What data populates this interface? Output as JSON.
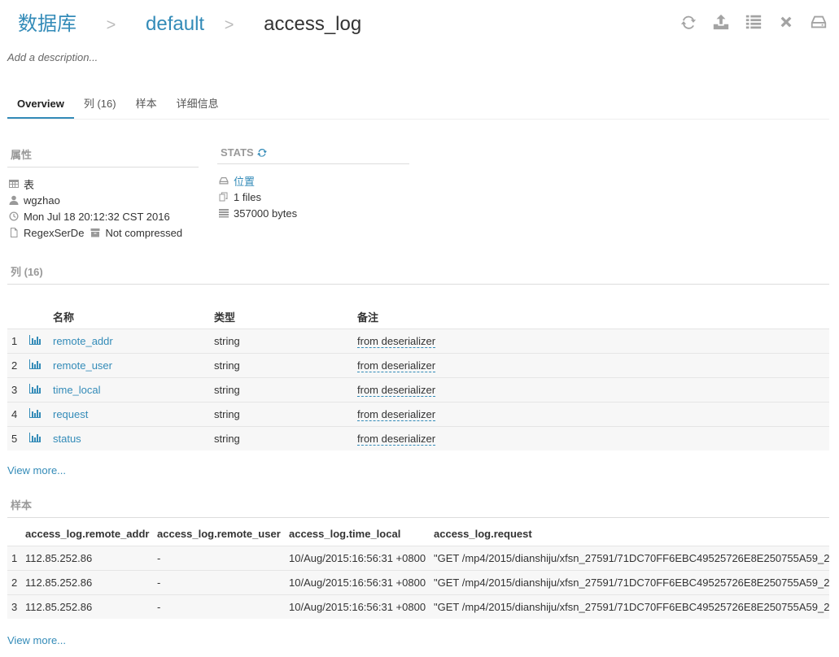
{
  "breadcrumb": {
    "database_label": "数据库",
    "sep1": ">",
    "db_name": "default",
    "sep2": ">",
    "table_name": "access_log"
  },
  "toolbar": {
    "icons": [
      "refresh-icon",
      "upload-icon",
      "list-icon",
      "close-icon",
      "drive-icon"
    ]
  },
  "description_placeholder": "Add a description...",
  "tabs": [
    {
      "label": "Overview",
      "active": true
    },
    {
      "label": "列 (16)",
      "active": false
    },
    {
      "label": "样本",
      "active": false
    },
    {
      "label": "详细信息",
      "active": false
    }
  ],
  "properties": {
    "title": "属性",
    "type": "表",
    "owner": "wgzhao",
    "created": "Mon Jul 18 20:12:32 CST 2016",
    "serde": "RegexSerDe",
    "compression": "Not compressed"
  },
  "stats": {
    "title": "STATS",
    "location_label": "位置",
    "files": "1 files",
    "bytes": "357000 bytes"
  },
  "columns_section": {
    "title": "列 (16)",
    "headers": {
      "name": "名称",
      "type": "类型",
      "comment": "备注"
    },
    "rows": [
      {
        "index": "1",
        "name": "remote_addr",
        "type": "string",
        "comment": "from deserializer"
      },
      {
        "index": "2",
        "name": "remote_user",
        "type": "string",
        "comment": "from deserializer"
      },
      {
        "index": "3",
        "name": "time_local",
        "type": "string",
        "comment": "from deserializer"
      },
      {
        "index": "4",
        "name": "request",
        "type": "string",
        "comment": "from deserializer"
      },
      {
        "index": "5",
        "name": "status",
        "type": "string",
        "comment": "from deserializer"
      }
    ],
    "view_more": "View more..."
  },
  "sample_section": {
    "title": "样本",
    "headers": [
      "access_log.remote_addr",
      "access_log.remote_user",
      "access_log.time_local",
      "access_log.request"
    ],
    "rows": [
      {
        "index": "1",
        "cells": [
          "112.85.252.86",
          "-",
          "10/Aug/2015:16:56:31 +0800",
          "\"GET /mp4/2015/dianshiju/xfsn_27591/71DC70FF6EBC49525726E8E250755A59_2"
        ]
      },
      {
        "index": "2",
        "cells": [
          "112.85.252.86",
          "-",
          "10/Aug/2015:16:56:31 +0800",
          "\"GET /mp4/2015/dianshiju/xfsn_27591/71DC70FF6EBC49525726E8E250755A59_2"
        ]
      },
      {
        "index": "3",
        "cells": [
          "112.85.252.86",
          "-",
          "10/Aug/2015:16:56:31 +0800",
          "\"GET /mp4/2015/dianshiju/xfsn_27591/71DC70FF6EBC49525726E8E250755A59_2"
        ]
      }
    ],
    "view_more": "View more..."
  },
  "colors": {
    "link": "#338bb8",
    "muted": "#999999",
    "stripe": "#f7f7f7"
  }
}
